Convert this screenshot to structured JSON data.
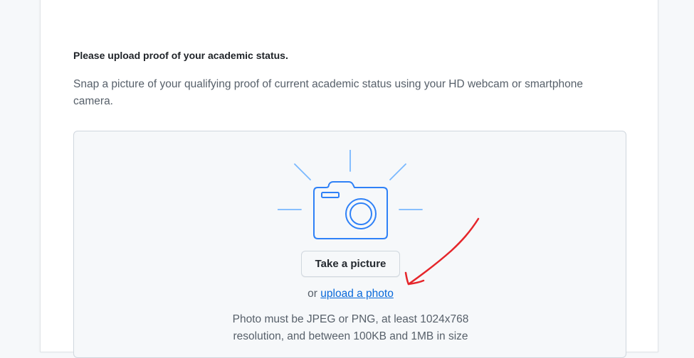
{
  "verification": {
    "heading": "Please upload proof of your academic status.",
    "description": "Snap a picture of your qualifying proof of current academic status using your HD webcam or smartphone camera.",
    "upload": {
      "take_picture_label": "Take a picture",
      "or_text": "or",
      "upload_link_label": "upload a photo",
      "requirements_line1": "Photo must be JPEG or PNG, at least 1024x768",
      "requirements_line2": "resolution, and between 100KB and 1MB in size"
    }
  },
  "icons": {
    "camera": "camera-icon",
    "annotation": "red-arrow-annotation"
  },
  "colors": {
    "link": "#0969da",
    "camera_stroke": "#2f81f7",
    "camera_rays": "#79b8ff",
    "annotation": "#e5262b"
  }
}
